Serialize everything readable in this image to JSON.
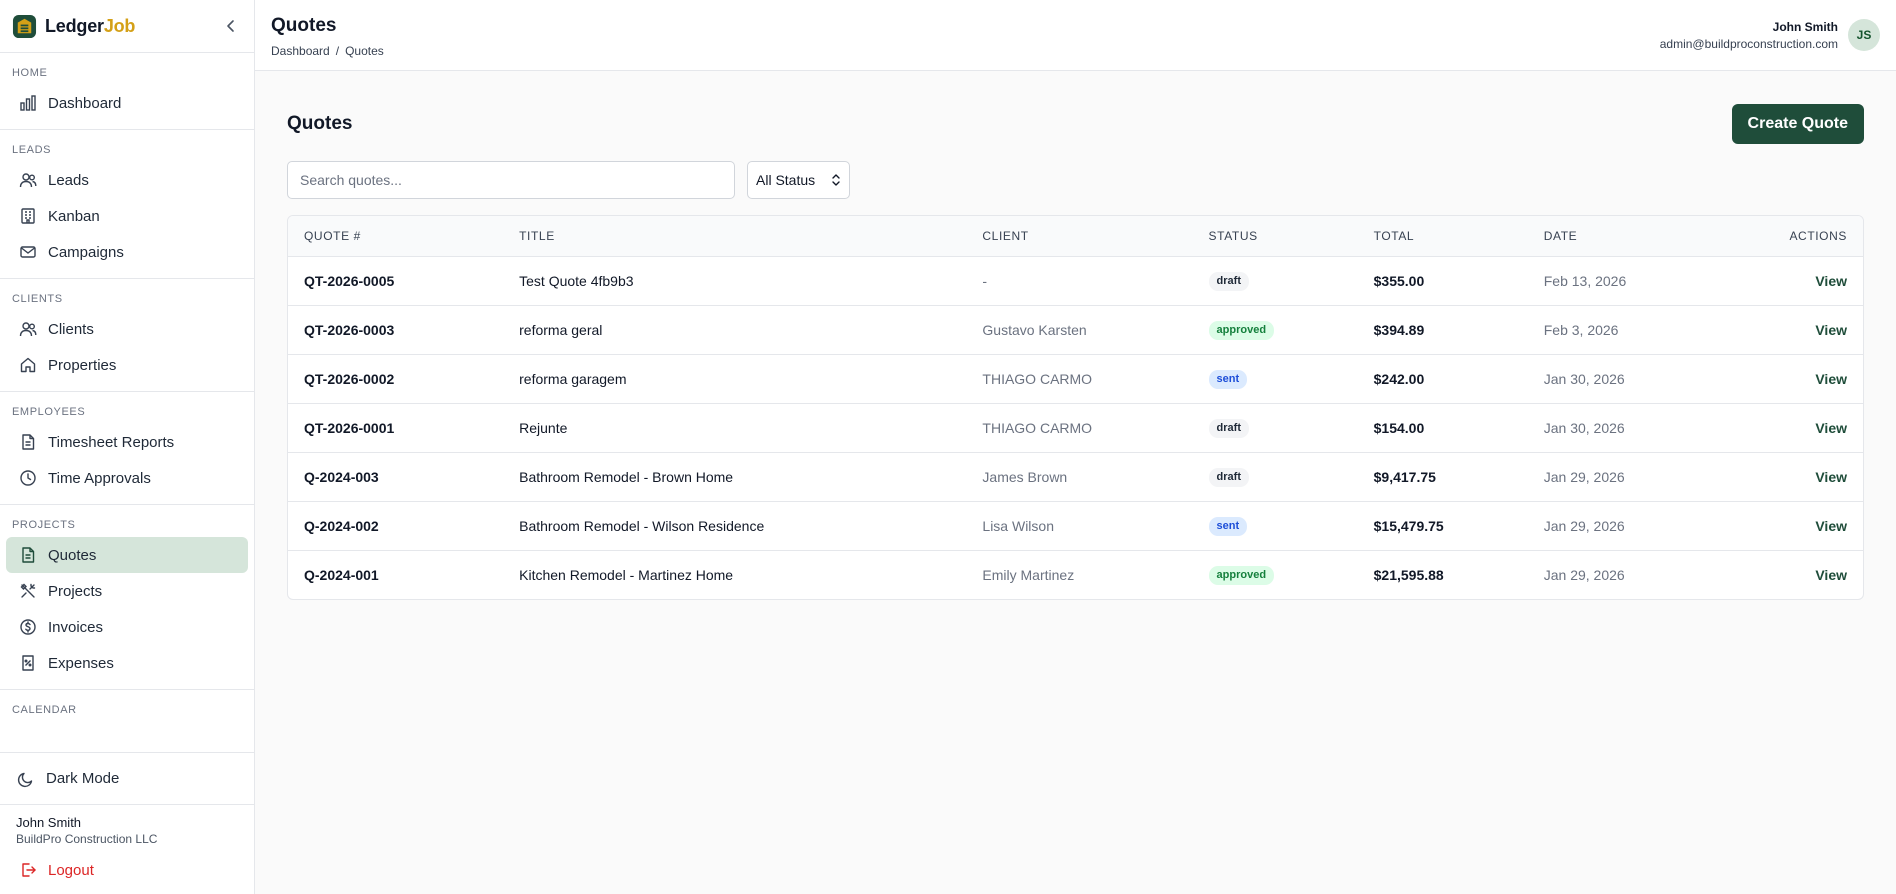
{
  "brand": {
    "name_part1": "Ledger",
    "name_part2": "Job",
    "accent_color": "#d4a017"
  },
  "sidebar": {
    "sections": [
      {
        "title": "HOME",
        "items": [
          {
            "label": "Dashboard",
            "icon": "chart-bars-icon",
            "active": false
          }
        ]
      },
      {
        "title": "LEADS",
        "items": [
          {
            "label": "Leads",
            "icon": "users-icon",
            "active": false
          },
          {
            "label": "Kanban",
            "icon": "building-icon",
            "active": false
          },
          {
            "label": "Campaigns",
            "icon": "mail-icon",
            "active": false
          }
        ]
      },
      {
        "title": "CLIENTS",
        "items": [
          {
            "label": "Clients",
            "icon": "users-icon",
            "active": false
          },
          {
            "label": "Properties",
            "icon": "home-icon",
            "active": false
          }
        ]
      },
      {
        "title": "EMPLOYEES",
        "items": [
          {
            "label": "Timesheet Reports",
            "icon": "file-text-icon",
            "active": false
          },
          {
            "label": "Time Approvals",
            "icon": "clock-icon",
            "active": false
          }
        ]
      },
      {
        "title": "PROJECTS",
        "items": [
          {
            "label": "Quotes",
            "icon": "file-text-icon",
            "active": true
          },
          {
            "label": "Projects",
            "icon": "tools-icon",
            "active": false
          },
          {
            "label": "Invoices",
            "icon": "dollar-circle-icon",
            "active": false
          },
          {
            "label": "Expenses",
            "icon": "receipt-icon",
            "active": false
          }
        ]
      },
      {
        "title": "CALENDAR",
        "items": []
      }
    ],
    "dark_mode_label": "Dark Mode",
    "user_name": "John Smith",
    "company": "BuildPro Construction LLC",
    "logout_label": "Logout"
  },
  "header": {
    "title": "Quotes",
    "breadcrumb": {
      "parent": "Dashboard",
      "separator": "/",
      "current": "Quotes"
    },
    "user_name": "John Smith",
    "user_email": "admin@buildproconstruction.com",
    "avatar_initials": "JS"
  },
  "page": {
    "title": "Quotes",
    "create_button": "Create Quote",
    "search_placeholder": "Search quotes...",
    "status_filter": "All Status"
  },
  "table": {
    "columns": [
      "QUOTE #",
      "TITLE",
      "CLIENT",
      "STATUS",
      "TOTAL",
      "DATE",
      "ACTIONS"
    ],
    "rows": [
      {
        "quote": "QT-2026-0005",
        "title": "Test Quote 4fb9b3",
        "client": "-",
        "status": "draft",
        "total": "$355.00",
        "date": "Feb 13, 2026",
        "action": "View"
      },
      {
        "quote": "QT-2026-0003",
        "title": "reforma geral",
        "client": "Gustavo Karsten",
        "status": "approved",
        "total": "$394.89",
        "date": "Feb 3, 2026",
        "action": "View"
      },
      {
        "quote": "QT-2026-0002",
        "title": "reforma garagem",
        "client": "THIAGO CARMO",
        "status": "sent",
        "total": "$242.00",
        "date": "Jan 30, 2026",
        "action": "View"
      },
      {
        "quote": "QT-2026-0001",
        "title": "Rejunte",
        "client": "THIAGO CARMO",
        "status": "draft",
        "total": "$154.00",
        "date": "Jan 30, 2026",
        "action": "View"
      },
      {
        "quote": "Q-2024-003",
        "title": "Bathroom Remodel - Brown Home",
        "client": "James Brown",
        "status": "draft",
        "total": "$9,417.75",
        "date": "Jan 29, 2026",
        "action": "View"
      },
      {
        "quote": "Q-2024-002",
        "title": "Bathroom Remodel - Wilson Residence",
        "client": "Lisa Wilson",
        "status": "sent",
        "total": "$15,479.75",
        "date": "Jan 29, 2026",
        "action": "View"
      },
      {
        "quote": "Q-2024-001",
        "title": "Kitchen Remodel - Martinez Home",
        "client": "Emily Martinez",
        "status": "approved",
        "total": "$21,595.88",
        "date": "Jan 29, 2026",
        "action": "View"
      }
    ]
  },
  "colors": {
    "primary": "#1f4d3a",
    "active_nav": "#d5e5da",
    "logout": "#dc2626"
  }
}
